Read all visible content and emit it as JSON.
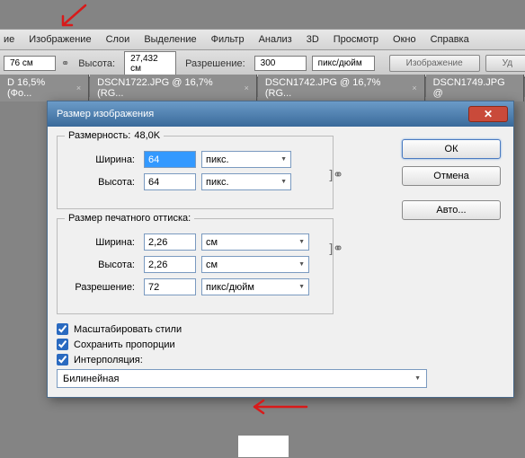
{
  "menu": {
    "m0": "ие",
    "m1": "Изображение",
    "m2": "Слои",
    "m3": "Выделение",
    "m4": "Фильтр",
    "m5": "Анализ",
    "m6": "3D",
    "m7": "Просмотр",
    "m8": "Окно",
    "m9": "Справка"
  },
  "opt": {
    "wval": "76 см",
    "hlbl": "Высота:",
    "hval": "27,432 см",
    "rlbl": "Разрешение:",
    "rval": "300",
    "unit": "пикс/дюйм",
    "btn1": "Изображение",
    "btn2": "Уд"
  },
  "tabs": {
    "t0": "D 16,5% (Фо...",
    "t1": "DSCN1722.JPG @ 16,7% (RG...",
    "t2": "DSCN1742.JPG @ 16,7% (RG...",
    "t3": "DSCN1749.JPG @"
  },
  "dlg": {
    "title": "Размер изображения",
    "dims_lbl": "Размерность:",
    "dims_val": "48,0K",
    "w_lbl": "Ширина:",
    "w_val": "64",
    "w_unit": "пикс.",
    "h_lbl": "Высота:",
    "h_val": "64",
    "h_unit": "пикс.",
    "print_lbl": "Размер печатного оттиска:",
    "pw_lbl": "Ширина:",
    "pw_val": "2,26",
    "pw_unit": "см",
    "ph_lbl": "Высота:",
    "ph_val": "2,26",
    "ph_unit": "см",
    "res_lbl": "Разрешение:",
    "res_val": "72",
    "res_unit": "пикс/дюйм",
    "chk1": "Масштабировать стили",
    "chk2": "Сохранить пропорции",
    "chk3": "Интерполяция:",
    "interp": "Билинейная",
    "ok": "ОК",
    "cancel": "Отмена",
    "auto": "Авто..."
  }
}
